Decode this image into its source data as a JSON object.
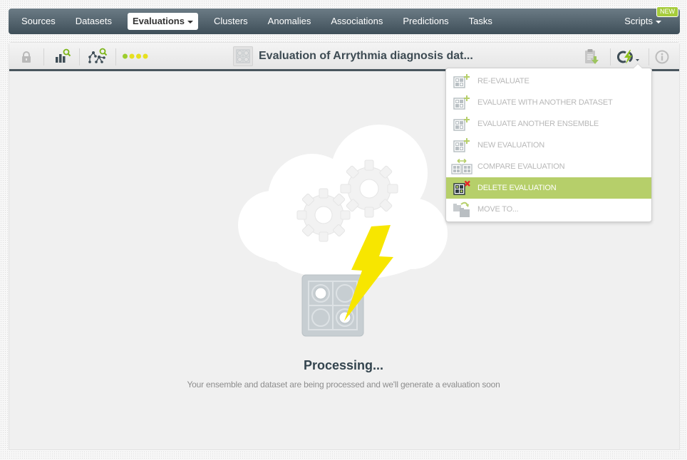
{
  "nav": {
    "items": [
      {
        "label": "Sources"
      },
      {
        "label": "Datasets"
      },
      {
        "label": "Evaluations",
        "active": true
      },
      {
        "label": "Clusters"
      },
      {
        "label": "Anomalies"
      },
      {
        "label": "Associations"
      },
      {
        "label": "Predictions"
      },
      {
        "label": "Tasks"
      }
    ],
    "scripts_label": "Scripts",
    "new_badge": "NEW"
  },
  "toolbar": {
    "title": "Evaluation of Arrythmia diagnosis dat...",
    "icons": [
      "lock-icon",
      "bar-chart-search-icon",
      "tree-search-icon",
      "status-dots-icon",
      "evaluation-thumbnail-icon",
      "clipboard-download-icon",
      "actions-lightning-icon",
      "info-icon"
    ],
    "status_dot_colors": [
      "#9ccd2c",
      "#e6e01f",
      "#e6e01f",
      "#e6e01f"
    ]
  },
  "menu": {
    "items": [
      {
        "label": "RE-EVALUATE",
        "icon": "evaluation-add-icon"
      },
      {
        "label": "EVALUATE WITH ANOTHER DATASET",
        "icon": "evaluation-add-icon"
      },
      {
        "label": "EVALUATE ANOTHER ENSEMBLE",
        "icon": "evaluation-add-icon"
      },
      {
        "label": "NEW EVALUATION",
        "icon": "evaluation-add-icon"
      },
      {
        "label": "COMPARE EVALUATION",
        "icon": "compare-evaluation-icon"
      },
      {
        "label": "DELETE EVALUATION",
        "icon": "delete-evaluation-icon",
        "highlighted": true
      },
      {
        "label": "MOVE TO...",
        "icon": "move-folder-icon"
      }
    ]
  },
  "main": {
    "title": "Processing...",
    "subtitle": "Your ensemble and dataset are being processed and we'll generate a evaluation soon"
  },
  "colors": {
    "accent_green": "#b6cf6a",
    "nav_dark": "#4a565e",
    "lightning_yellow": "#f7e600",
    "delete_red": "#e8232a"
  }
}
